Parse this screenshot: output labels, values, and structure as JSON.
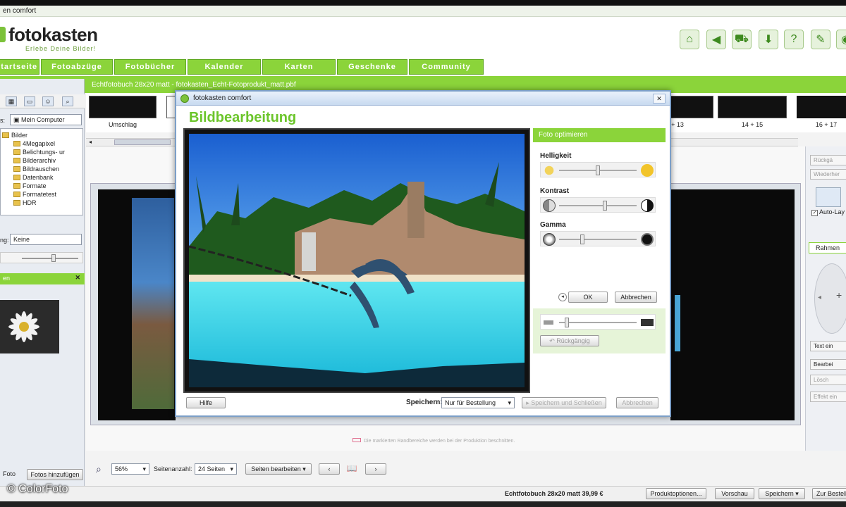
{
  "window": {
    "title": "en comfort"
  },
  "header": {
    "logo": "fotokasten",
    "slogan": "Erlebe Deine Bilder!",
    "icons": [
      "home-icon",
      "back-icon",
      "cart-icon",
      "download-icon",
      "help-icon",
      "tools-icon",
      "camera-icon"
    ]
  },
  "nav": {
    "items": [
      "Startseite",
      "Fotoabzüge",
      "Fotobücher",
      "Kalender",
      "Karten",
      "Geschenke",
      "Community"
    ]
  },
  "tab": {
    "title": "Echtfotobuch 28x20 matt - fotokasten_Echt-Fotoprodukt_matt.pbf"
  },
  "left": {
    "source_label": "s:",
    "source_value": "Mein Computer",
    "tree": [
      "Bilder",
      "4Megapixel",
      "Belichtungs- ur",
      "Bilderarchiv",
      "Bildrauschen",
      "Datenbank",
      "Formate",
      "Formatetest",
      "HDR"
    ],
    "sort_label": "ng:",
    "sort_value": "Keine",
    "panel_title": "en",
    "photo_button": "Foto",
    "add_button": "Fotos hinzufügen"
  },
  "filmstrip": {
    "labels": [
      "Umschlag",
      "+ 13",
      "14 + 15",
      "16 + 17"
    ]
  },
  "right": {
    "buttons": [
      "Rückgä",
      "Wiederher"
    ],
    "autolayout": "Auto-Lay",
    "tab": "Rahmen",
    "actions": [
      "Text ein",
      "Bearbei",
      "Lösch",
      "Effekt ein"
    ]
  },
  "workspace": {
    "notice": "Die markierten Randbereiche werden bei der Produktion beschnitten."
  },
  "bottom": {
    "zoom": "56%",
    "pages_label": "Seitenanzahl:",
    "pages_value": "24 Seiten",
    "edit_pages": "Seiten bearbeiten"
  },
  "status": {
    "product": "Echtfotobuch 28x20 matt 39,99 €",
    "options": "Produktoptionen...",
    "preview": "Vorschau",
    "save": "Speichern",
    "cart": "Zur Bestellu"
  },
  "watermark": "© ColorFoto",
  "dialog": {
    "title": "fotokasten comfort",
    "close": "✕",
    "heading": "Bildbearbeitung",
    "panel_title": "Foto optimieren",
    "brightness": "Helligkeit",
    "contrast": "Kontrast",
    "gamma": "Gamma",
    "ok": "OK",
    "cancel": "Abbrechen",
    "undo": "Rückgängig",
    "help": "Hilfe",
    "save_label": "Speichern:",
    "save_value": "Nur für Bestellung",
    "save_close": "Speichern und Schließen",
    "cancel2": "Abbrechen"
  },
  "colors": {
    "accent": "#8bd43a",
    "accent_dark": "#5fa821",
    "heading": "#6bc52a"
  }
}
